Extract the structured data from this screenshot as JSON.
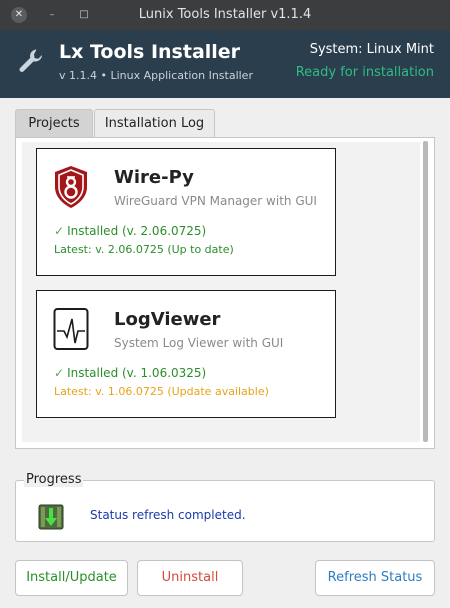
{
  "window": {
    "title": "Lunix Tools Installer v1.1.4",
    "close_glyph": "✕",
    "min_glyph": "–",
    "max_glyph": "□"
  },
  "header": {
    "icon": "wrench-icon",
    "title": "Lx Tools Installer",
    "subtitle": "v 1.1.4 • Linux Application Installer",
    "system": "System: Linux Mint",
    "status": "Ready for installation",
    "status_color": "#2ebd83",
    "background_color": "#2b3e4e"
  },
  "tabs": [
    {
      "label": "Projects",
      "active": true
    },
    {
      "label": "Installation Log",
      "active": false
    }
  ],
  "projects": [
    {
      "icon": "wirepy-shield-icon",
      "name": "Wire-Py",
      "description": "WireGuard VPN Manager with GUI",
      "installed": "Installed (v. 2.06.0725)",
      "latest": "Latest: v. 2.06.0725 (Up to date)",
      "latest_color": "#2a8f2a"
    },
    {
      "icon": "log-waveform-icon",
      "name": "LogViewer",
      "description": "System Log Viewer with GUI",
      "installed": "Installed (v. 1.06.0325)",
      "latest": "Latest: v. 1.06.0725 (Update available)",
      "latest_color": "#e8a317"
    }
  ],
  "progress": {
    "label": "Progress",
    "icon": "download-archive-icon",
    "status_text": "Status refresh completed."
  },
  "buttons": {
    "install": "Install/Update",
    "uninstall": "Uninstall",
    "refresh": "Refresh Status"
  },
  "check_glyph": "✓"
}
